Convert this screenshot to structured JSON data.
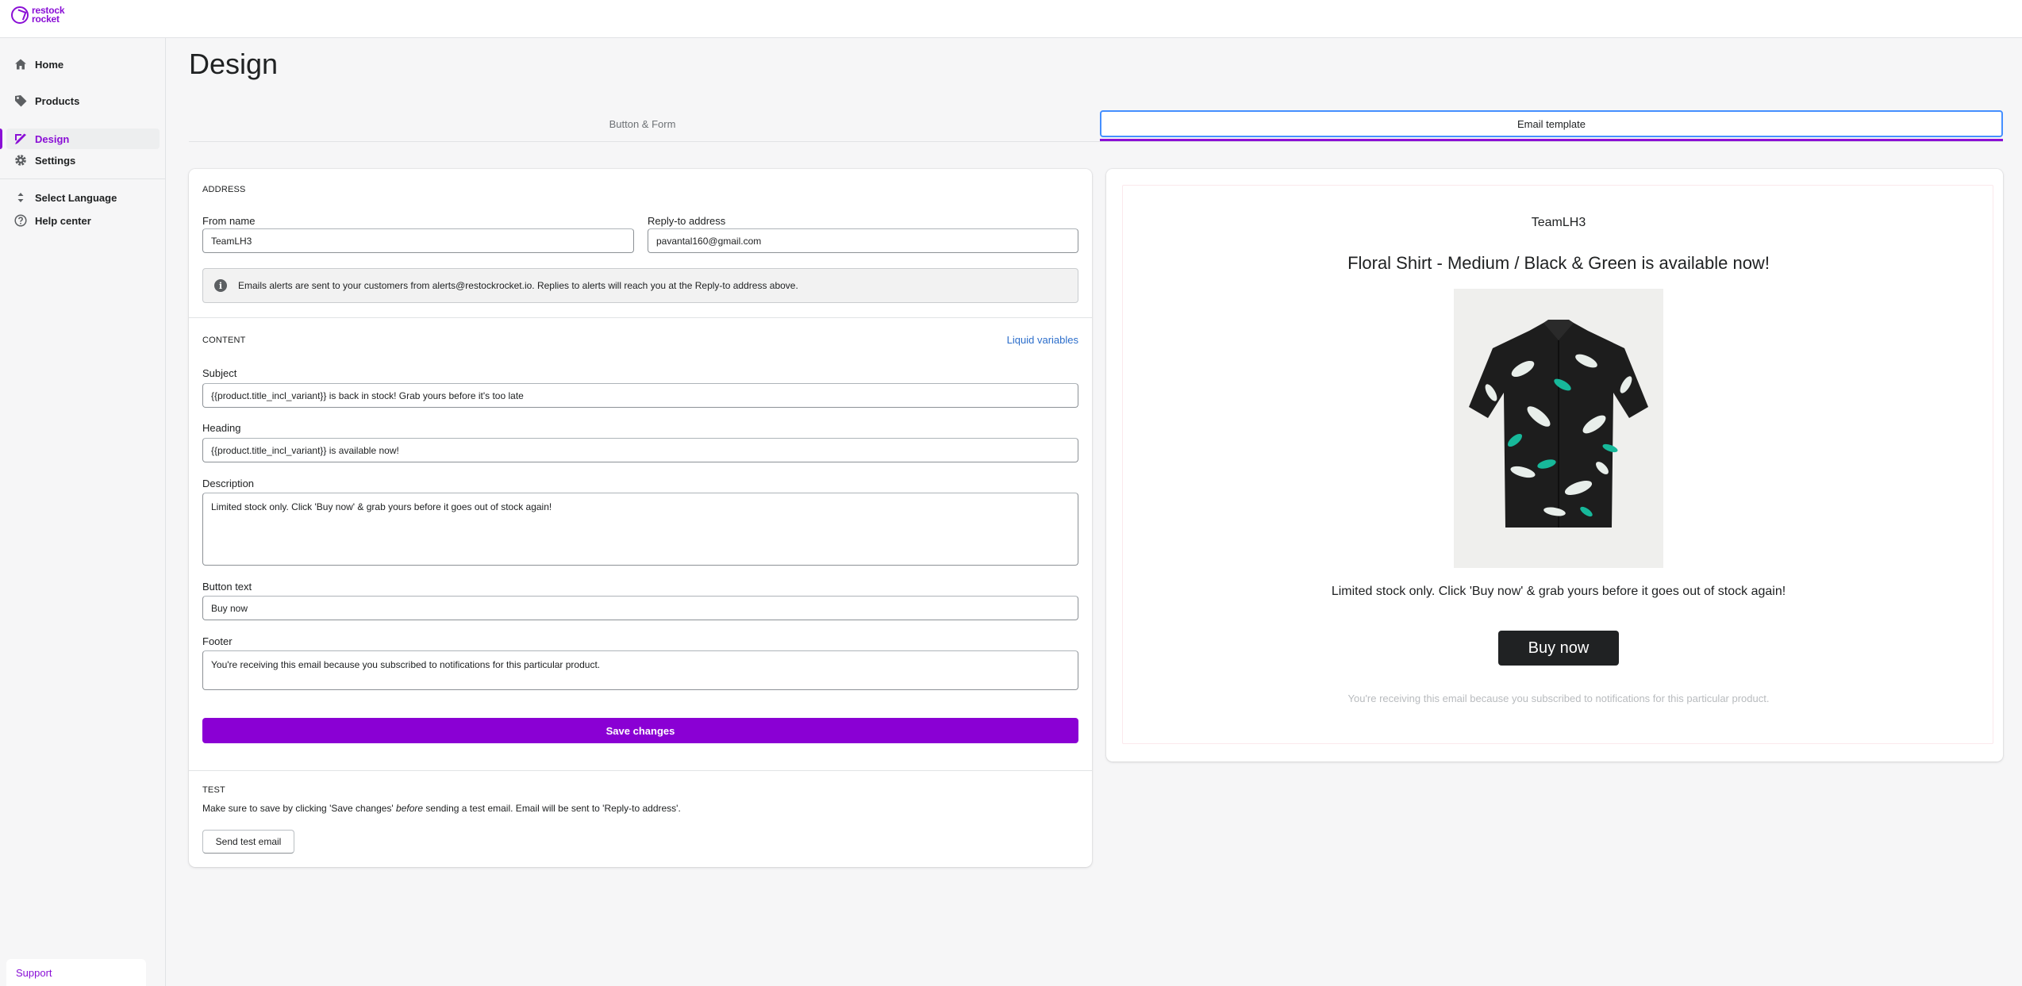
{
  "app": {
    "logo_line1": "restock",
    "logo_line2": "rocket"
  },
  "sidebar": {
    "items": [
      {
        "label": "Home",
        "icon": "home-icon"
      },
      {
        "label": "Products",
        "icon": "tag-icon"
      },
      {
        "label": "Design",
        "icon": "brush-icon"
      },
      {
        "label": "Settings",
        "icon": "gear-icon"
      },
      {
        "label": "Select Language",
        "icon": "sort-icon"
      },
      {
        "label": "Help center",
        "icon": "question-icon"
      }
    ],
    "active_index": 2,
    "support_label": "Support"
  },
  "page": {
    "title": "Design"
  },
  "tabs": [
    {
      "label": "Button & Form",
      "selected": false
    },
    {
      "label": "Email template",
      "selected": true
    }
  ],
  "address": {
    "section_title": "ADDRESS",
    "from_name_label": "From name",
    "from_name_value": "TeamLH3",
    "reply_to_label": "Reply-to address",
    "reply_to_value": "pavantal160@gmail.com",
    "banner_text": "Emails alerts are sent to your customers from alerts@restockrocket.io. Replies to alerts will reach you at the Reply-to address above."
  },
  "content": {
    "section_title": "CONTENT",
    "liquid_link": "Liquid variables",
    "subject_label": "Subject",
    "subject_value": "{{product.title_incl_variant}} is back in stock! Grab yours before it's too late",
    "heading_label": "Heading",
    "heading_value": "{{product.title_incl_variant}} is available now!",
    "description_label": "Description",
    "description_value": "Limited stock only. Click 'Buy now' & grab yours before it goes out of stock again!",
    "button_text_label": "Button text",
    "button_text_value": "Buy now",
    "footer_label": "Footer",
    "footer_value": "You're receiving this email because you subscribed to notifications for this particular product.",
    "save_label": "Save changes"
  },
  "test": {
    "section_title": "TEST",
    "help_before": "Make sure to save by clicking 'Save changes' ",
    "help_em": "before",
    "help_after": " sending a test email. Email will be sent to 'Reply-to address'.",
    "send_label": "Send test email"
  },
  "preview": {
    "store_name": "TeamLH3",
    "heading": "Floral Shirt - Medium / Black & Green is available now!",
    "description": "Limited stock only. Click 'Buy now' & grab yours before it goes out of stock again!",
    "button_label": "Buy now",
    "footer": "You're receiving this email because you subscribed to notifications for this particular product."
  },
  "colors": {
    "accent": "#8a0fd6",
    "primary_button": "#8a00d4",
    "link": "#2c6ecb",
    "preview_button": "#202223"
  }
}
